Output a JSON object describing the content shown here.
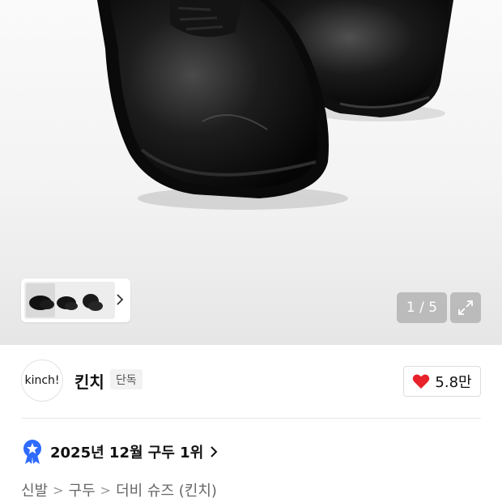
{
  "gallery": {
    "counter_text": "1 / 5",
    "thumbnail_icon": "shoe-thumbnails",
    "next_icon": "chevron-right-icon",
    "expand_icon": "expand-icon"
  },
  "brand": {
    "logo_text": "kinch!",
    "name": "킨치",
    "badge": "단독",
    "likes": "5.8만",
    "like_icon": "heart-icon",
    "like_color": "#e8212a"
  },
  "ranking": {
    "icon": "award-badge-icon",
    "icon_color": "#2f6bff",
    "text": "2025년 12월 구두 1위"
  },
  "breadcrumb": {
    "items": [
      "신발",
      "구두",
      "더비 슈즈 (킨치)"
    ],
    "separator": ">"
  }
}
